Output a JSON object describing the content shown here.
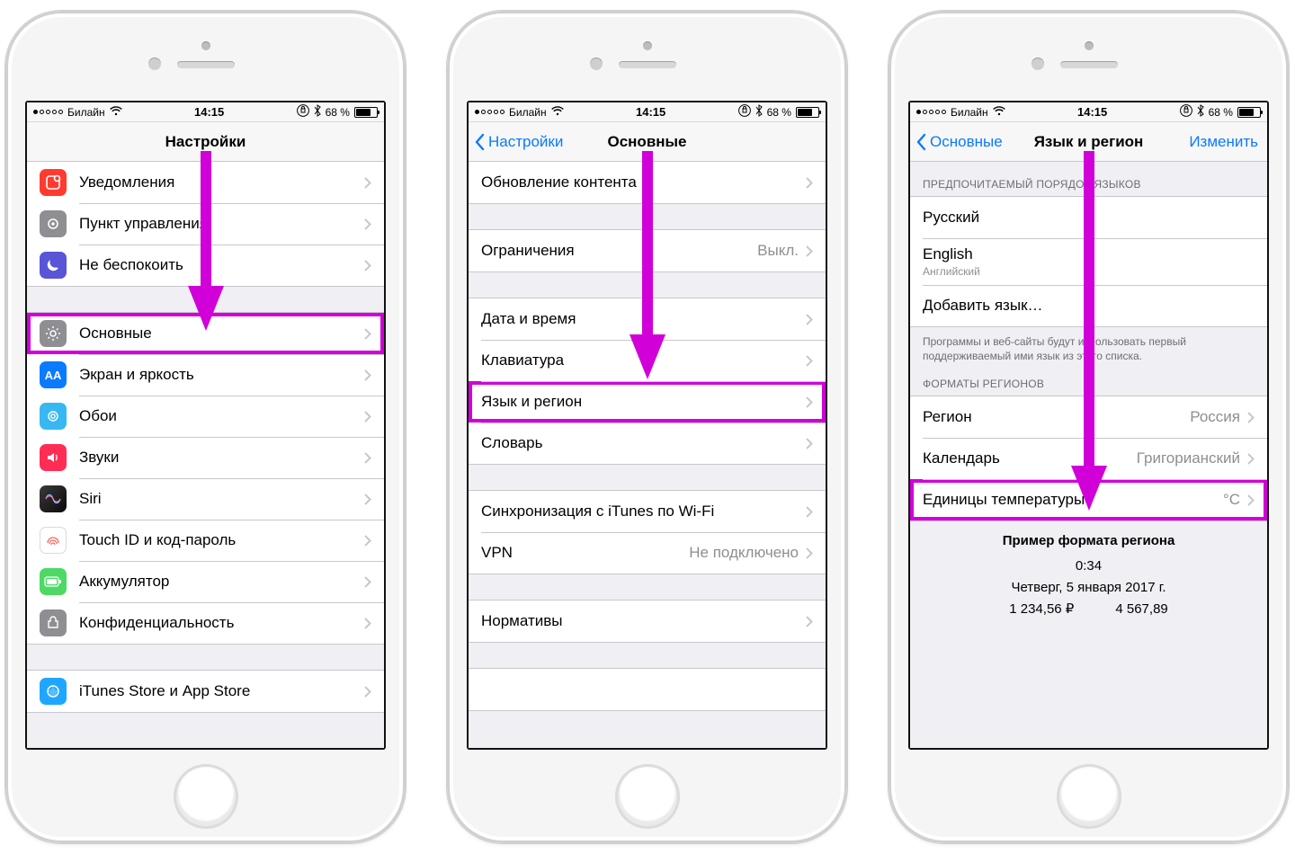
{
  "statusbar": {
    "carrier": "Билайн",
    "time": "14:15",
    "battery_text": "68 %",
    "battery_percent": 68
  },
  "screen1": {
    "title": "Настройки",
    "items": {
      "notifications": "Уведомления",
      "control_center": "Пункт управления",
      "dnd": "Не беспокоить",
      "general": "Основные",
      "display": "Экран и яркость",
      "wallpaper": "Обои",
      "sounds": "Звуки",
      "siri": "Siri",
      "touchid": "Touch ID и код-пароль",
      "battery": "Аккумулятор",
      "privacy": "Конфиденциальность",
      "itunes": "iTunes Store и App Store"
    }
  },
  "screen2": {
    "back": "Настройки",
    "title": "Основные",
    "items": {
      "content_update": "Обновление контента",
      "restrictions": "Ограничения",
      "restrictions_value": "Выкл.",
      "date_time": "Дата и время",
      "keyboard": "Клавиатура",
      "language_region": "Язык и регион",
      "dictionary": "Словарь",
      "itunes_wifi": "Синхронизация с iTunes по Wi-Fi",
      "vpn": "VPN",
      "vpn_value": "Не подключено",
      "regulatory": "Нормативы"
    }
  },
  "screen3": {
    "back": "Основные",
    "title": "Язык и регион",
    "edit": "Изменить",
    "sections": {
      "preferred_title": "ПРЕДПОЧИТАЕМЫЙ ПОРЯДОК ЯЗЫКОВ",
      "formats_title": "ФОРМАТЫ РЕГИОНОВ",
      "note": "Программы и веб-сайты будут использовать первый поддерживаемый ими язык из этого списка.",
      "russian": "Русский",
      "english": "English",
      "english_native": "Английский",
      "add_language": "Добавить язык…",
      "region_label": "Регион",
      "region_value": "Россия",
      "calendar_label": "Календарь",
      "calendar_value": "Григорианский",
      "temp_label": "Единицы температуры",
      "temp_value": "°C",
      "example_title": "Пример формата региона",
      "example_time": "0:34",
      "example_date": "Четверг, 5 января 2017 г.",
      "example_num1": "1 234,56 ₽",
      "example_num2": "4 567,89"
    }
  },
  "icon_colors": {
    "notifications": "#ff3b30",
    "control_center": "#8e8e93",
    "dnd": "#5856d6",
    "general": "#8e8e93",
    "display": "#0a7aff",
    "wallpaper": "#38b8f2",
    "sounds": "#ff2d55",
    "siri": "#111111",
    "touchid": "#ff3b30",
    "battery": "#4cd964",
    "privacy": "#8e8e93",
    "itunes": "#1fa7ff"
  }
}
